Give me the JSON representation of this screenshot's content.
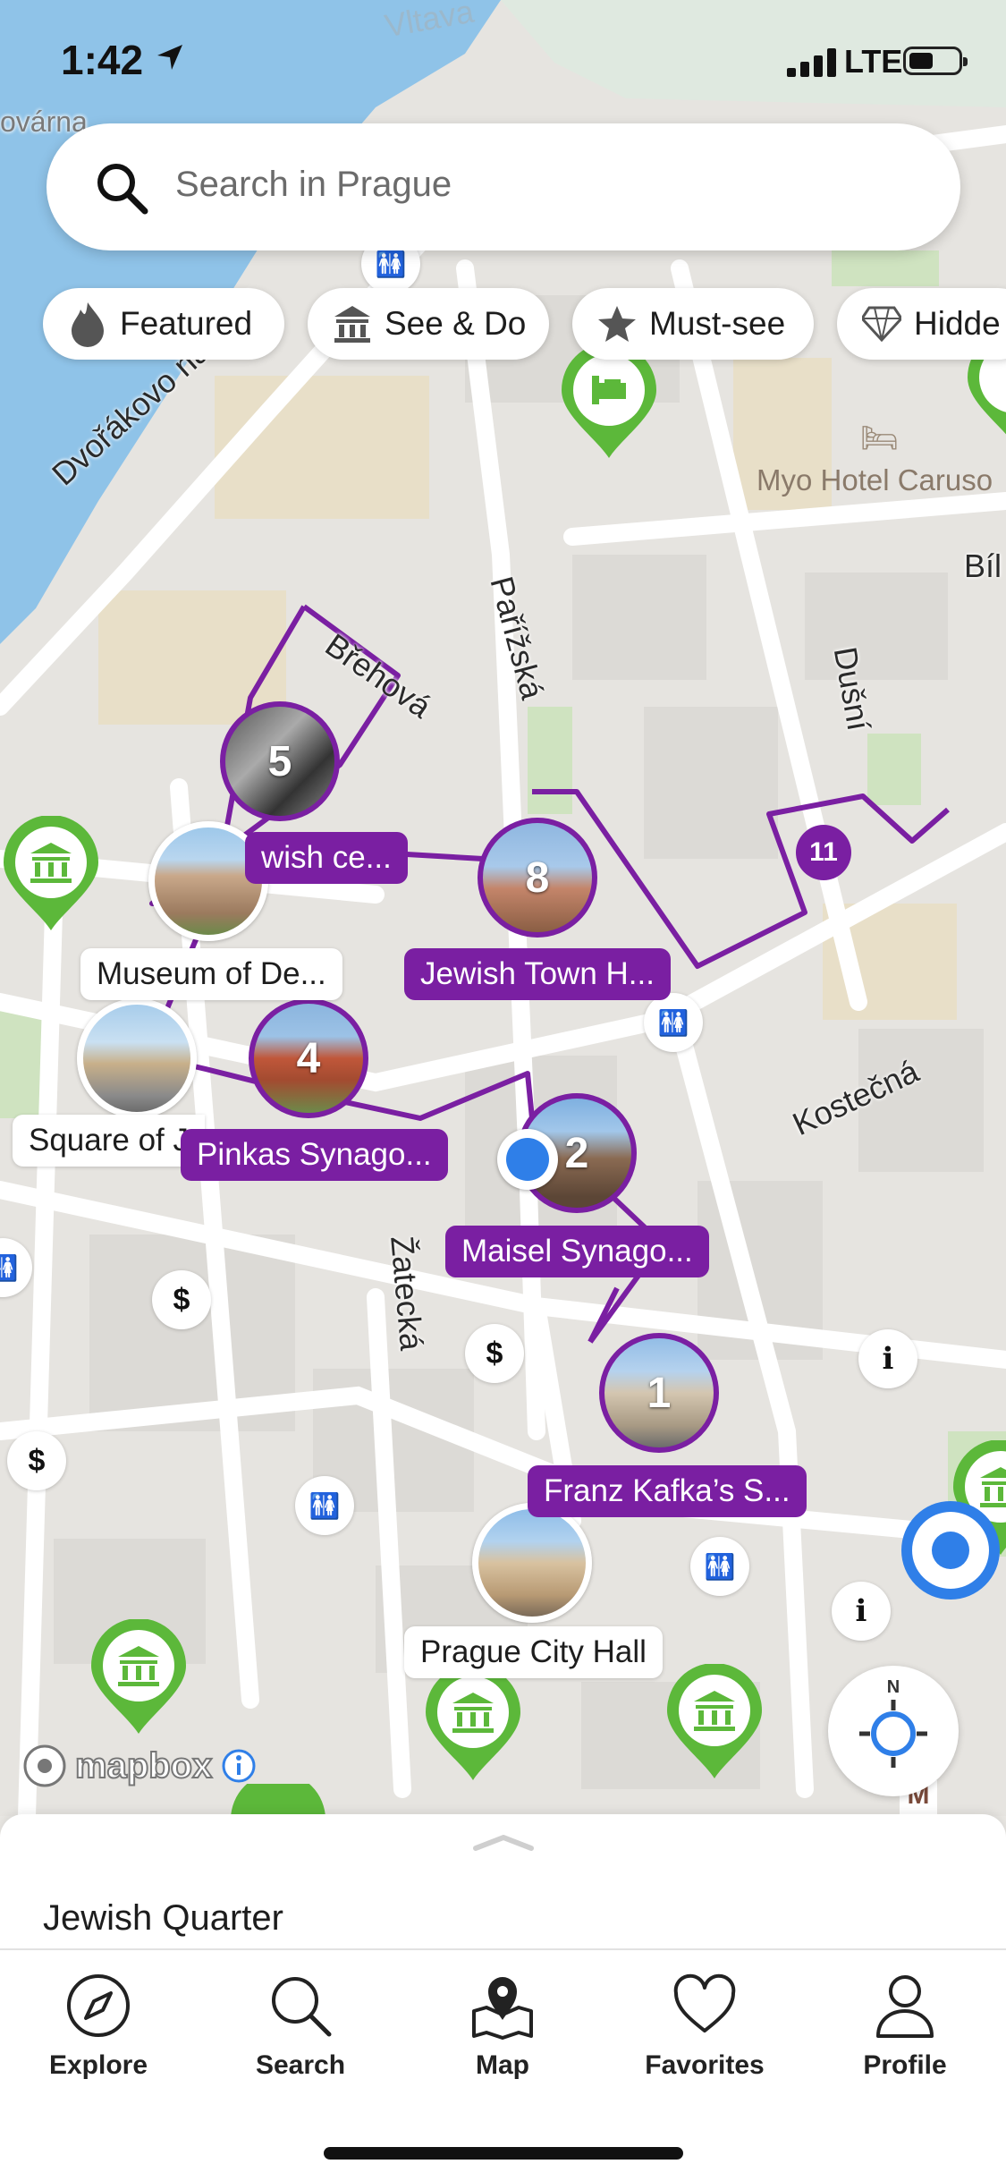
{
  "status": {
    "time": "1:42",
    "network": "LTE"
  },
  "search": {
    "placeholder": "Search in Prague"
  },
  "chips": [
    {
      "label": "Featured",
      "icon": "flame-icon"
    },
    {
      "label": "See & Do",
      "icon": "museum-icon"
    },
    {
      "label": "Must-see",
      "icon": "star-icon"
    },
    {
      "label": "Hidde",
      "icon": "diamond-icon"
    }
  ],
  "map": {
    "river_label": "Vltava",
    "top_label": "ovárna",
    "streets": [
      "Dvořákovo nábřeží",
      "Břehová",
      "Pařížská",
      "Dušní",
      "Kostečná",
      "Žatecká",
      "Bíl"
    ],
    "hotel": "Myo Hotel Caruso",
    "stops": [
      {
        "number": "5",
        "label": "wish ce..."
      },
      {
        "number": "8",
        "label": "Jewish Town H..."
      },
      {
        "number": "4",
        "label": "Pinkas Synago..."
      },
      {
        "number": "2",
        "label": "Maisel Synago..."
      },
      {
        "number": "1",
        "label": "Franz Kafka’s S..."
      },
      {
        "number": "11",
        "label": ""
      }
    ],
    "places": [
      {
        "label": "Museum of De..."
      },
      {
        "label": "Square of J"
      },
      {
        "label": "Prague City Hall"
      }
    ],
    "attribution": "mapbox"
  },
  "sheet": {
    "title": "Jewish Quarter"
  },
  "tabs": [
    {
      "label": "Explore",
      "icon": "compass-icon"
    },
    {
      "label": "Search",
      "icon": "search-icon"
    },
    {
      "label": "Map",
      "icon": "map-pin-icon"
    },
    {
      "label": "Favorites",
      "icon": "heart-icon"
    },
    {
      "label": "Profile",
      "icon": "person-icon"
    }
  ],
  "colors": {
    "route": "#7a1fa2",
    "pin_green": "#5cb83a",
    "water": "#8fc3e8",
    "user_dot": "#2f7fe8"
  }
}
